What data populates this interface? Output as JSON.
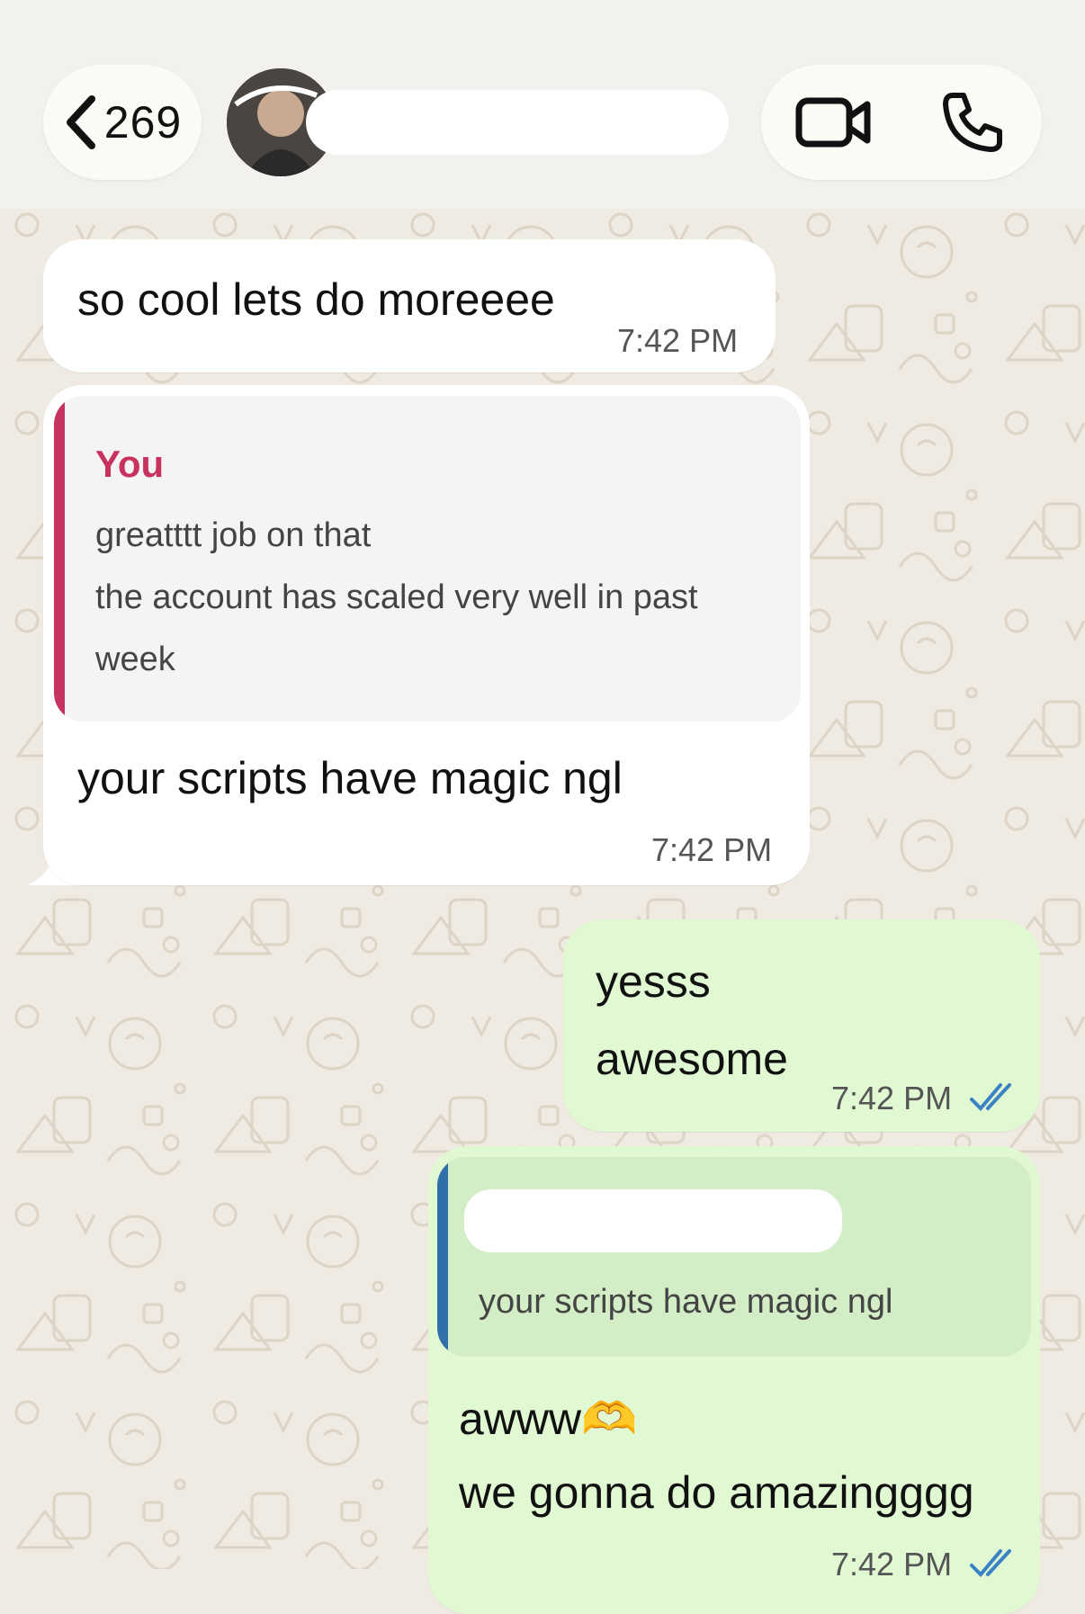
{
  "header": {
    "back_count": "269",
    "contact_name": "",
    "icons": [
      "chevron-left-icon",
      "video-call-icon",
      "phone-call-icon"
    ]
  },
  "colors": {
    "incoming_bubble": "#ffffff",
    "outgoing_bubble": "#e1f9d3",
    "quote_you_accent": "#c8325e",
    "quote_other_accent": "#2f6faa",
    "read_ticks": "#3b82c4",
    "chat_background": "#efeae2"
  },
  "messages": [
    {
      "direction": "incoming",
      "text": "so cool lets do moreeee",
      "time": "7:42 PM"
    },
    {
      "direction": "incoming",
      "quote": {
        "author": "You",
        "lines": [
          "greatttt job on that",
          "the account has scaled very well in past",
          "week"
        ]
      },
      "text": "your scripts have magic ngl",
      "time": "7:42 PM"
    },
    {
      "direction": "outgoing",
      "lines": [
        "yesss",
        "awesome"
      ],
      "time": "7:42 PM",
      "status": "read"
    },
    {
      "direction": "outgoing",
      "quote": {
        "author": "",
        "lines": [
          "your scripts have magic ngl"
        ]
      },
      "lines": [
        "awww🫶",
        "we gonna do amazingggg"
      ],
      "time": "7:42 PM",
      "status": "read"
    }
  ]
}
